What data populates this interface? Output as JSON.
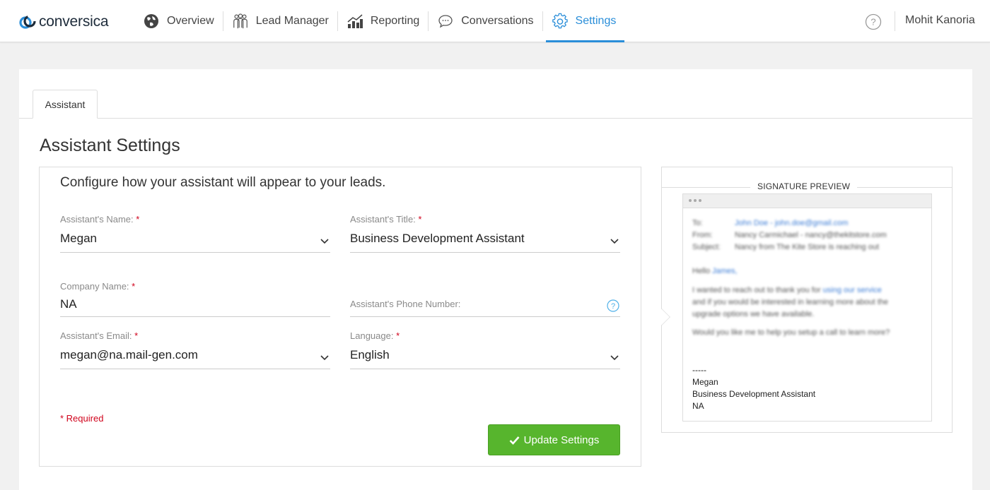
{
  "brand": {
    "name": "conversica"
  },
  "nav": {
    "items": [
      {
        "label": "Overview",
        "icon": "globe-icon"
      },
      {
        "label": "Lead Manager",
        "icon": "people-icon"
      },
      {
        "label": "Reporting",
        "icon": "bar-chart-icon"
      },
      {
        "label": "Conversations",
        "icon": "chat-bubble-icon"
      },
      {
        "label": "Settings",
        "icon": "gear-icon",
        "active": true
      }
    ]
  },
  "header": {
    "user_name": "Mohit Kanoria",
    "help_icon": "help-circle-icon"
  },
  "tabs": [
    {
      "label": "Assistant"
    }
  ],
  "page": {
    "title": "Assistant Settings",
    "intro": "Configure how your assistant will appear to your leads."
  },
  "form": {
    "name": {
      "label": "Assistant's Name:",
      "value": "Megan"
    },
    "title": {
      "label": "Assistant's Title:",
      "value": "Business Development Assistant"
    },
    "company": {
      "label": "Company Name:",
      "value": "NA"
    },
    "phone": {
      "label": "Assistant's Phone Number:",
      "value": ""
    },
    "email": {
      "label": "Assistant's Email:",
      "value": "megan@na.mail-gen.com"
    },
    "language": {
      "label": "Language:",
      "value": "English"
    },
    "required_marker": "*",
    "required_note": "* Required",
    "submit_label": "Update Settings"
  },
  "preview": {
    "title": "SIGNATURE PREVIEW",
    "to_label": "To:",
    "to_value": "John Doe - john.doe@gmail.com",
    "from_label": "From:",
    "from_value": "Nancy Carmichael - nancy@thekitstore.com",
    "subject_label": "Subject:",
    "subject_value": "Nancy from The Kite Store is reaching out",
    "greeting_prefix": "Hello ",
    "greeting_name": "James,",
    "body_line1_prefix": "I wanted to reach out to thank you for ",
    "body_line1_link": "using our service",
    "body_line2": "and if you would be interested in learning more about the",
    "body_line3": "upgrade options we have available.",
    "body_line4": "Would you like me to help you setup a call to learn more?",
    "sig_separator": "-----",
    "sig_name": "Megan",
    "sig_title": "Business Development Assistant",
    "sig_company": "NA"
  },
  "colors": {
    "accent": "#2a8ed9",
    "success": "#57b52d",
    "required": "#d0021b"
  }
}
